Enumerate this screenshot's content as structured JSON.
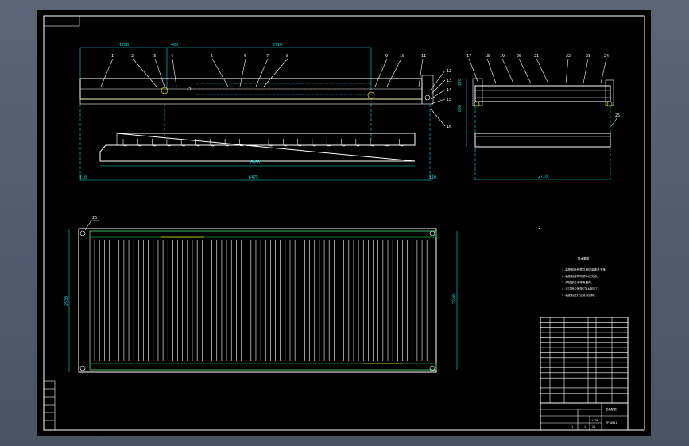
{
  "drawing": {
    "front_view": {
      "overall_length": "6475",
      "inner_length": "6400",
      "left_offset": "1728",
      "gap": "408",
      "span": "2710",
      "end_left": "110",
      "end_right": "110",
      "callouts": [
        "1",
        "2",
        "3",
        "4",
        "5",
        "6",
        "7",
        "8",
        "9",
        "10",
        "11",
        "12",
        "13",
        "14",
        "15",
        "16"
      ]
    },
    "side_view": {
      "width": "2710",
      "height": "800",
      "small": "270",
      "callouts": [
        "17",
        "18",
        "19",
        "20",
        "21",
        "22",
        "23",
        "24",
        "25"
      ]
    },
    "plan_view": {
      "height_left": "2530",
      "height_right": "2240",
      "callout": "26"
    },
    "notes": {
      "heading": "技术要求",
      "items": [
        "1.装配前所有零件用煤油清洗干净。",
        "2.装配后各转动部件应灵活。",
        "3.焊接部位不得有虚焊。",
        "4.未注明公差按IT14级加工。",
        "5.装配后进行空载试运转。"
      ]
    },
    "title_block": {
      "drawing_name": "总装配图",
      "drawing_number": "ZP-0001",
      "scale": "1:20",
      "sheet": "1",
      "of": "1",
      "total": "25"
    }
  },
  "colors": {
    "background": "#4f5867",
    "sheet": "#000000",
    "outline": "#ffffff",
    "dimension": "#00e0e0",
    "highlight": "#e8e800",
    "hatch": "#00d040"
  }
}
